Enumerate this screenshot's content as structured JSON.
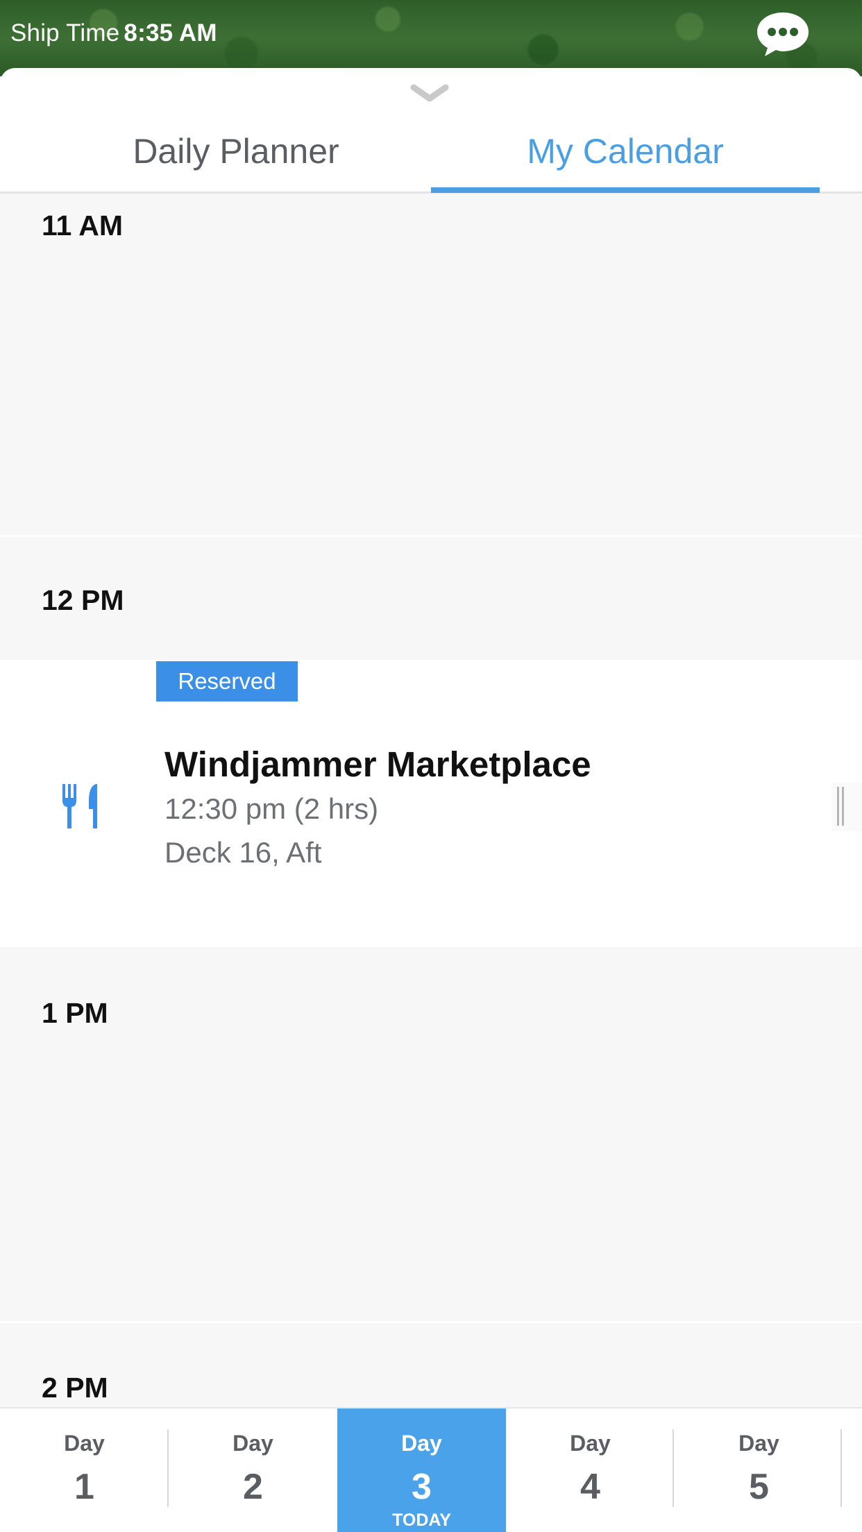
{
  "header": {
    "ship_time_label": "Ship Time",
    "ship_time_value": "8:35 AM",
    "chat_icon": "chat-bubble-icon"
  },
  "tabs": [
    {
      "label": "Daily Planner",
      "active": false
    },
    {
      "label": "My Calendar",
      "active": true
    }
  ],
  "hours": [
    "11 AM",
    "12 PM",
    "1 PM",
    "2 PM"
  ],
  "event": {
    "badge": "Reserved",
    "title": "Windjammer Marketplace",
    "time": "12:30 pm (2 hrs)",
    "location": "Deck 16, Aft",
    "icon": "fork-knife-icon"
  },
  "days": [
    {
      "word": "Day",
      "num": "1"
    },
    {
      "word": "Day",
      "num": "2"
    },
    {
      "word": "Day",
      "num": "3",
      "today": "TODAY"
    },
    {
      "word": "Day",
      "num": "4"
    },
    {
      "word": "Day",
      "num": "5"
    }
  ],
  "colors": {
    "accent": "#4a9fe4",
    "badge": "#3b8fe6",
    "active_day": "#4aa3ea"
  }
}
